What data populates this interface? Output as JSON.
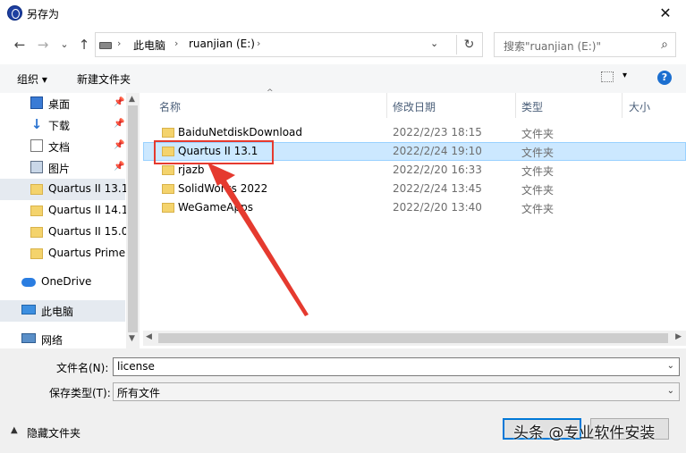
{
  "window": {
    "title": "另存为",
    "close": "✕"
  },
  "nav": {
    "back": "←",
    "forward": "→",
    "recent": "⌄",
    "up": "↑",
    "breadcrumbs": [
      "此电脑",
      "ruanjian (E:)"
    ],
    "separator": "›",
    "dropdown": "⌄",
    "refresh": "↻",
    "search_placeholder": "搜索\"ruanjian (E:)\"",
    "search_icon": "⌕"
  },
  "toolbar": {
    "organize": "组织 ▾",
    "new_folder": "新建文件夹",
    "view_dd": "▾",
    "help": "?"
  },
  "sidebar": {
    "items": [
      {
        "label": "桌面",
        "icon": "desktop-icon",
        "pinned": true
      },
      {
        "label": "下载",
        "icon": "download-icon",
        "pinned": true,
        "glyph": "↓"
      },
      {
        "label": "文档",
        "icon": "document-icon",
        "pinned": true
      },
      {
        "label": "图片",
        "icon": "pictures-icon",
        "pinned": true
      },
      {
        "label": "Quartus II 13.1",
        "icon": "folder-icon"
      },
      {
        "label": "Quartus II 14.1",
        "icon": "folder-icon"
      },
      {
        "label": "Quartus II 15.0",
        "icon": "folder-icon"
      },
      {
        "label": "Quartus Prime",
        "icon": "folder-icon"
      },
      {
        "label": "OneDrive",
        "icon": "onedrive-icon"
      },
      {
        "label": "此电脑",
        "icon": "this-pc-icon"
      },
      {
        "label": "网络",
        "icon": "network-icon"
      }
    ],
    "pin": "📌",
    "scroll_up": "▲",
    "scroll_down": "▼"
  },
  "columns": {
    "name": "名称",
    "modified": "修改日期",
    "type": "类型",
    "size": "大小",
    "sort_caret": "^"
  },
  "files": [
    {
      "name": "BaiduNetdiskDownload",
      "modified": "2022/2/23 18:15",
      "type": "文件夹"
    },
    {
      "name": "Quartus II 13.1",
      "modified": "2022/2/24 19:10",
      "type": "文件夹"
    },
    {
      "name": "rjazb",
      "modified": "2022/2/20 16:33",
      "type": "文件夹"
    },
    {
      "name": "SolidWorks 2022",
      "modified": "2022/2/24 13:45",
      "type": "文件夹"
    },
    {
      "name": "WeGameApps",
      "modified": "2022/2/20 13:40",
      "type": "文件夹"
    }
  ],
  "selected_file": "Quartus II 13.1",
  "hscroll": {
    "left": "◀",
    "right": "▶"
  },
  "form": {
    "filename_label": "文件名(N):",
    "filename_value": "license",
    "filetype_label": "保存类型(T):",
    "filetype_value": "所有文件",
    "dropdown": "⌄"
  },
  "footer": {
    "hide_toggle": "▲",
    "hide_folders": "隐藏文件夹",
    "watermark": "头条 @专业软件安装"
  },
  "colors": {
    "accent": "#0078d7",
    "selection": "#cce8ff",
    "annotation": "#e53a2f",
    "folder": "#f4d36c"
  }
}
